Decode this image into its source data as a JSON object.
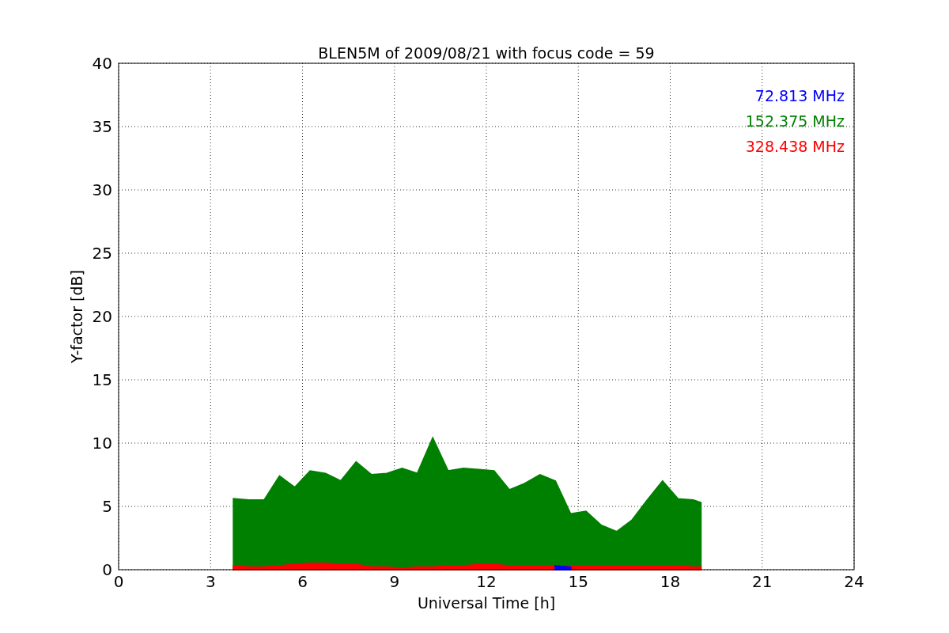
{
  "chart_data": {
    "type": "area",
    "title": "BLEN5M of 2009/08/21 with focus code = 59",
    "xlabel": "Universal Time [h]",
    "ylabel": "Y-factor [dB]",
    "x": [
      3.75,
      4.25,
      4.75,
      5.25,
      5.75,
      6.25,
      6.75,
      7.25,
      7.75,
      8.25,
      8.75,
      9.25,
      9.75,
      10.25,
      10.75,
      11.25,
      11.75,
      12.25,
      12.75,
      13.25,
      13.75,
      14.25,
      14.75,
      15.25,
      15.75,
      16.25,
      16.75,
      17.25,
      17.75,
      18.25,
      18.75,
      19.0
    ],
    "series": [
      {
        "name": "72.813 MHz",
        "color": "#0000ff",
        "values": [
          null,
          null,
          null,
          null,
          null,
          null,
          null,
          null,
          null,
          null,
          null,
          null,
          null,
          null,
          null,
          null,
          null,
          null,
          null,
          null,
          null,
          0.3,
          0.2,
          null,
          null,
          null,
          null,
          null,
          null,
          null,
          null,
          null
        ]
      },
      {
        "name": "152.375 MHz",
        "color": "#008000",
        "values": [
          5.6,
          5.5,
          5.5,
          7.4,
          6.5,
          7.8,
          7.6,
          7.0,
          8.5,
          7.5,
          7.6,
          8.0,
          7.6,
          10.4,
          7.8,
          8.0,
          7.9,
          7.8,
          6.3,
          6.8,
          7.5,
          7.0,
          4.4,
          4.6,
          3.5,
          3.0,
          3.9,
          5.5,
          7.0,
          5.6,
          5.5,
          5.3
        ]
      },
      {
        "name": "328.438 MHz",
        "color": "#ff0000",
        "values": [
          0.3,
          0.2,
          0.2,
          0.3,
          0.4,
          0.5,
          0.5,
          0.4,
          0.4,
          0.2,
          0.2,
          0.1,
          0.2,
          0.2,
          0.3,
          0.3,
          0.4,
          0.4,
          0.3,
          0.3,
          0.3,
          0.3,
          0.3,
          0.3,
          0.3,
          0.3,
          0.3,
          0.3,
          0.3,
          0.3,
          0.2,
          0.2
        ]
      }
    ],
    "xlim": [
      0,
      24
    ],
    "ylim": [
      0,
      40
    ],
    "xticks": [
      0,
      3,
      6,
      9,
      12,
      15,
      18,
      21,
      24
    ],
    "yticks": [
      0,
      5,
      10,
      15,
      20,
      25,
      30,
      35,
      40
    ],
    "grid": true
  }
}
